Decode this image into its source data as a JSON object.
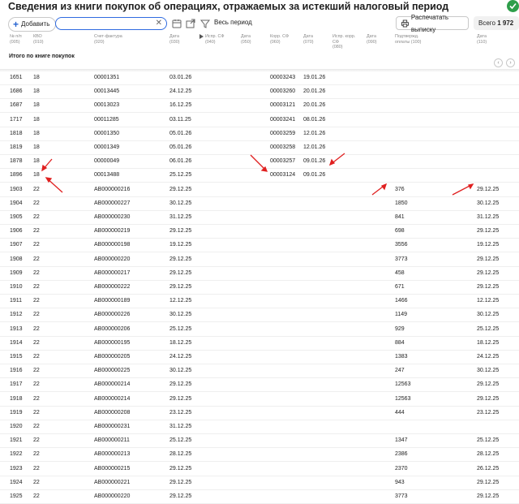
{
  "title": "Сведения из книги покупок об операциях, отражаемых за истекший налоговый период",
  "toolbar": {
    "add_label": "Добавить",
    "search_placeholder": "",
    "period_label": "Весь период",
    "print_label": "Распечатать выписку",
    "total_label": "Всего",
    "total_count": "1 972"
  },
  "columns": [
    {
      "key": "n",
      "label": "№ п/п\n(005)"
    },
    {
      "key": "kvo",
      "label": "КВО\n(010)"
    },
    {
      "key": "sf",
      "label": "Счет-фактура\n(020)"
    },
    {
      "key": "date1",
      "label": "Дата\n(030)"
    },
    {
      "key": "ispr",
      "label": "Испр. СФ\n(040)"
    },
    {
      "key": "date2",
      "label": "Дата\n(050)"
    },
    {
      "key": "korr",
      "label": "Корр. СФ\n(060)"
    },
    {
      "key": "date3",
      "label": "Дата\n(070)"
    },
    {
      "key": "ispr_korr",
      "label": "Испр. корр.\nСФ\n(080)"
    },
    {
      "key": "date4",
      "label": "Дата\n(090)"
    },
    {
      "key": "podtv",
      "label": "Подтвержд.\nоплаты (100)"
    },
    {
      "key": "date5",
      "label": "Дата\n(110)"
    }
  ],
  "total_row_label": "Итого по книге покупок",
  "rows": [
    {
      "n": "1651",
      "kvo": "18",
      "sf": "00001351",
      "date1": "03.01.26",
      "korr": "00003243",
      "date3": "19.01.26",
      "podtv": "",
      "date5": ""
    },
    {
      "n": "1686",
      "kvo": "18",
      "sf": "00013445",
      "date1": "24.12.25",
      "korr": "00003260",
      "date3": "20.01.26",
      "podtv": "",
      "date5": ""
    },
    {
      "n": "1687",
      "kvo": "18",
      "sf": "00013023",
      "date1": "16.12.25",
      "korr": "00003121",
      "date3": "20.01.26",
      "podtv": "",
      "date5": ""
    },
    {
      "n": "1717",
      "kvo": "18",
      "sf": "00011285",
      "date1": "03.11.25",
      "korr": "00003241",
      "date3": "08.01.26",
      "podtv": "",
      "date5": ""
    },
    {
      "n": "1818",
      "kvo": "18",
      "sf": "00001350",
      "date1": "05.01.26",
      "korr": "00003259",
      "date3": "12.01.26",
      "podtv": "",
      "date5": ""
    },
    {
      "n": "1819",
      "kvo": "18",
      "sf": "00001349",
      "date1": "05.01.26",
      "korr": "00003258",
      "date3": "12.01.26",
      "podtv": "",
      "date5": ""
    },
    {
      "n": "1878",
      "kvo": "18",
      "sf": "00000049",
      "date1": "06.01.26",
      "korr": "00003257",
      "date3": "09.01.26",
      "podtv": "",
      "date5": ""
    },
    {
      "n": "1896",
      "kvo": "18",
      "sf": "00013488",
      "date1": "25.12.25",
      "korr": "00003124",
      "date3": "09.01.26",
      "podtv": "",
      "date5": ""
    },
    {
      "n": "1903",
      "kvo": "22",
      "sf": "АВ000000216",
      "date1": "29.12.25",
      "korr": "",
      "date3": "",
      "podtv": "376",
      "date5": "29.12.25"
    },
    {
      "n": "1904",
      "kvo": "22",
      "sf": "АВ000000227",
      "date1": "30.12.25",
      "korr": "",
      "date3": "",
      "podtv": "1850",
      "date5": "30.12.25"
    },
    {
      "n": "1905",
      "kvo": "22",
      "sf": "АВ000000230",
      "date1": "31.12.25",
      "korr": "",
      "date3": "",
      "podtv": "841",
      "date5": "31.12.25"
    },
    {
      "n": "1906",
      "kvo": "22",
      "sf": "АВ000000219",
      "date1": "29.12.25",
      "korr": "",
      "date3": "",
      "podtv": "698",
      "date5": "29.12.25"
    },
    {
      "n": "1907",
      "kvo": "22",
      "sf": "АВ000000198",
      "date1": "19.12.25",
      "korr": "",
      "date3": "",
      "podtv": "3556",
      "date5": "19.12.25"
    },
    {
      "n": "1908",
      "kvo": "22",
      "sf": "АВ000000220",
      "date1": "29.12.25",
      "korr": "",
      "date3": "",
      "podtv": "3773",
      "date5": "29.12.25"
    },
    {
      "n": "1909",
      "kvo": "22",
      "sf": "АВ000000217",
      "date1": "29.12.25",
      "korr": "",
      "date3": "",
      "podtv": "458",
      "date5": "29.12.25"
    },
    {
      "n": "1910",
      "kvo": "22",
      "sf": "АВ000000222",
      "date1": "29.12.25",
      "korr": "",
      "date3": "",
      "podtv": "671",
      "date5": "29.12.25"
    },
    {
      "n": "1911",
      "kvo": "22",
      "sf": "АВ000000189",
      "date1": "12.12.25",
      "korr": "",
      "date3": "",
      "podtv": "1466",
      "date5": "12.12.25"
    },
    {
      "n": "1912",
      "kvo": "22",
      "sf": "АВ000000226",
      "date1": "30.12.25",
      "korr": "",
      "date3": "",
      "podtv": "1149",
      "date5": "30.12.25"
    },
    {
      "n": "1913",
      "kvo": "22",
      "sf": "АВ000000206",
      "date1": "25.12.25",
      "korr": "",
      "date3": "",
      "podtv": "929",
      "date5": "25.12.25"
    },
    {
      "n": "1914",
      "kvo": "22",
      "sf": "АВ000000195",
      "date1": "18.12.25",
      "korr": "",
      "date3": "",
      "podtv": "884",
      "date5": "18.12.25"
    },
    {
      "n": "1915",
      "kvo": "22",
      "sf": "АВ000000205",
      "date1": "24.12.25",
      "korr": "",
      "date3": "",
      "podtv": "1383",
      "date5": "24.12.25"
    },
    {
      "n": "1916",
      "kvo": "22",
      "sf": "АВ000000225",
      "date1": "30.12.25",
      "korr": "",
      "date3": "",
      "podtv": "247",
      "date5": "30.12.25"
    },
    {
      "n": "1917",
      "kvo": "22",
      "sf": "АВ000000214",
      "date1": "29.12.25",
      "korr": "",
      "date3": "",
      "podtv": "12563",
      "date5": "29.12.25"
    },
    {
      "n": "1918",
      "kvo": "22",
      "sf": "АВ000000214",
      "date1": "29.12.25",
      "korr": "",
      "date3": "",
      "podtv": "12563",
      "date5": "29.12.25"
    },
    {
      "n": "1919",
      "kvo": "22",
      "sf": "АВ000000208",
      "date1": "23.12.25",
      "korr": "",
      "date3": "",
      "podtv": "444",
      "date5": "23.12.25"
    },
    {
      "n": "1920",
      "kvo": "22",
      "sf": "АВ000000231",
      "date1": "31.12.25",
      "korr": "",
      "date3": "",
      "podtv": "",
      "date5": ""
    },
    {
      "n": "1921",
      "kvo": "22",
      "sf": "АВ000000211",
      "date1": "25.12.25",
      "korr": "",
      "date3": "",
      "podtv": "1347",
      "date5": "25.12.25"
    },
    {
      "n": "1922",
      "kvo": "22",
      "sf": "АВ000000213",
      "date1": "28.12.25",
      "korr": "",
      "date3": "",
      "podtv": "2386",
      "date5": "28.12.25"
    },
    {
      "n": "1923",
      "kvo": "22",
      "sf": "АВ000000215",
      "date1": "29.12.25",
      "korr": "",
      "date3": "",
      "podtv": "2370",
      "date5": "26.12.25"
    },
    {
      "n": "1924",
      "kvo": "22",
      "sf": "АВ000000221",
      "date1": "29.12.25",
      "korr": "",
      "date3": "",
      "podtv": "943",
      "date5": "29.12.25"
    },
    {
      "n": "1925",
      "kvo": "22",
      "sf": "АВ000000220",
      "date1": "29.12.25",
      "korr": "",
      "date3": "",
      "podtv": "3773",
      "date5": "29.12.25"
    }
  ],
  "colors": {
    "accent": "#2f6be0",
    "annotation": "#e02020",
    "ok": "#2e9e4a"
  }
}
